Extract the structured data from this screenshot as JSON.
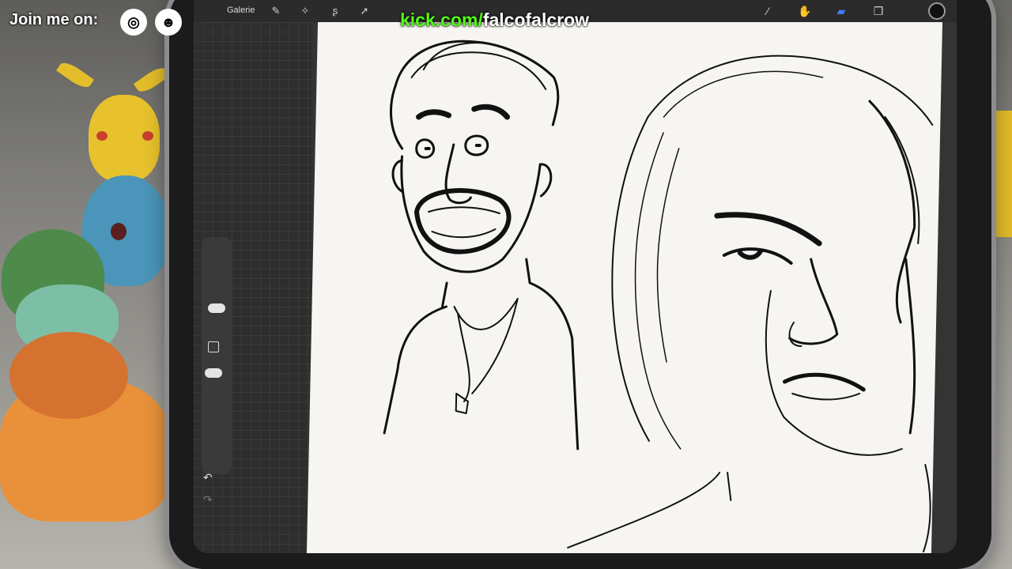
{
  "overlay": {
    "join_label": "Join me on:",
    "kick_prefix": "kick.com/",
    "kick_handle": "falcofalcrow",
    "kick_color": "#53fc18",
    "social_icons": [
      "instagram-icon",
      "discord-icon"
    ]
  },
  "toolbar": {
    "gallery_label": "Galerie",
    "left_tools": [
      "wrench-icon",
      "magic-wand-icon",
      "selection-icon",
      "transform-arrow-icon"
    ],
    "right_tools": [
      "brush-icon",
      "smudge-icon",
      "eraser-icon",
      "layers-icon"
    ],
    "active_tool": "eraser-icon",
    "active_color": "#3f7bff",
    "current_color": "#111111"
  },
  "sidebar": {
    "undo_icon": "undo-arrow-icon",
    "redo_icon": "redo-arrow-icon"
  }
}
